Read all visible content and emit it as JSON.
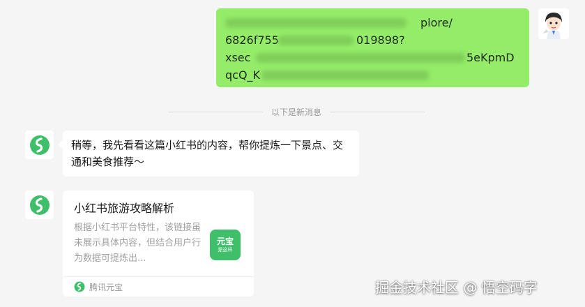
{
  "user_message": {
    "line1_visible": "plore/",
    "line2_visible_start": "6826f755",
    "line2_visible_end": "019898?",
    "line3_visible_start": "xsec",
    "line3_visible_end": "5eKpmD",
    "line4_visible_start": "qcQ_K"
  },
  "divider": {
    "label": "以下是新消息"
  },
  "bot_message": {
    "text": "稍等，我先看看这篇小红书的内容，帮你提炼一下景点、交通和美食推荐～"
  },
  "share_card": {
    "title": "小红书旅游攻略解析",
    "description": "根据小红书平台特性，该链接虽未展示具体内容，但结合用户行为数据可提炼出...",
    "thumb_text_main": "元宝",
    "thumb_text_sub": "是这样",
    "source": "腾讯元宝"
  },
  "watermark": "掘金技术社区 @ 悟空码字",
  "icons": {
    "bot_avatar": "yuanbao-logo-icon",
    "user_avatar": "cartoon-avatar-icon",
    "source_icon": "yuanbao-small-icon"
  },
  "colors": {
    "user_bubble": "#95ec69",
    "background": "#f5f5f5",
    "brand_green": "#3fbf6a"
  }
}
